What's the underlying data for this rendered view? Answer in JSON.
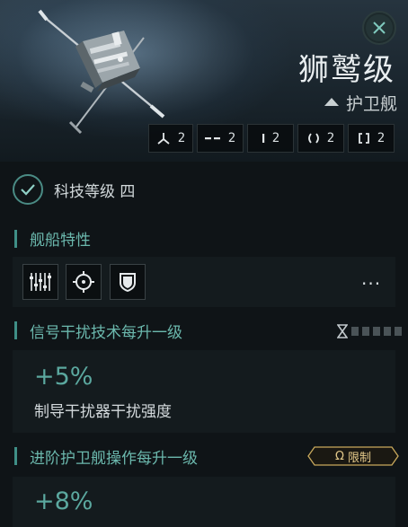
{
  "header": {
    "ship_name": "狮鹫级",
    "ship_class": "护卫舰",
    "slots": [
      {
        "icon": "turret-hardpoint-icon",
        "count": "2"
      },
      {
        "icon": "launcher-hardpoint-icon",
        "count": "2"
      },
      {
        "icon": "high-slot-icon",
        "count": "2"
      },
      {
        "icon": "mid-slot-icon",
        "count": "2"
      },
      {
        "icon": "low-slot-icon",
        "count": "2"
      }
    ]
  },
  "tech_level": {
    "label": "科技等级 四"
  },
  "traits": {
    "title": "舰船特性",
    "icons": [
      "ecm-modules-icon",
      "targeting-icon",
      "shield-icon"
    ],
    "more_label": "···"
  },
  "bonuses": [
    {
      "skill": "信号干扰技术每升一级",
      "value": "+5%",
      "description": "制导干扰器干扰强度",
      "skill_levels_trained": 0,
      "skill_levels_total": 5
    },
    {
      "skill": "进阶护卫舰操作每升一级",
      "value": "+8%",
      "tag": "限制"
    }
  ],
  "colors": {
    "accent": "#5ba89f",
    "tag_gold": "#e4c98a"
  }
}
